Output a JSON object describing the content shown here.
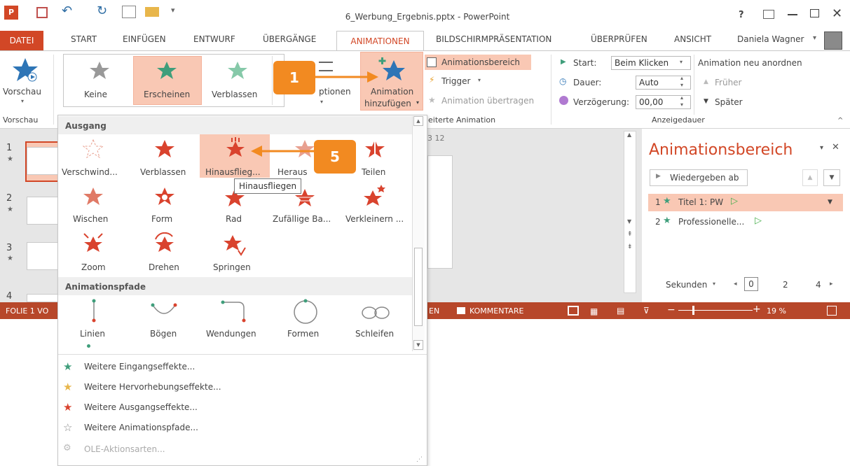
{
  "window": {
    "title": "6_Werbung_Ergebnis.pptx - PowerPoint",
    "help": "?",
    "user": "Daniela Wagner"
  },
  "tabs": [
    {
      "label": "DATEI"
    },
    {
      "label": "START"
    },
    {
      "label": "EINFÜGEN"
    },
    {
      "label": "ENTWURF"
    },
    {
      "label": "ÜBERGÄNGE"
    },
    {
      "label": "ANIMATIONEN"
    },
    {
      "label": "BILDSCHIRMPRÄSENTATION"
    },
    {
      "label": "ÜBERPRÜFEN"
    },
    {
      "label": "ANSICHT"
    }
  ],
  "ribbon": {
    "preview_button": "Vorschau",
    "preview_group": "Vorschau",
    "gallery": [
      "Keine",
      "Erscheinen",
      "Verblassen"
    ],
    "effect_options_partial": "ptionen",
    "add_animation_line1": "Animation",
    "add_animation_line2": "hinzufügen",
    "animation_pane_button": "Animationsbereich",
    "trigger_button": "Trigger",
    "copy_animation_button": "Animation übertragen",
    "advanced_group_partial": "eiterte Animation",
    "start_label": "Start:",
    "start_value": "Beim Klicken",
    "duration_label": "Dauer:",
    "duration_value": "Auto",
    "delay_label": "Verzögerung:",
    "delay_value": "00,00",
    "timing_group": "Anzeigedauer",
    "reorder_title": "Animation neu anordnen",
    "earlier": "Früher",
    "later": "Später"
  },
  "dropdown": {
    "exit_header": "Ausgang",
    "exit_effects": [
      "Verschwind...",
      "Verblassen",
      "Hinausflieg...",
      "Heraus",
      "Teilen",
      "Wischen",
      "Form",
      "Rad",
      "Zufällige Ba...",
      "Verkleinern ...",
      "Zoom",
      "Drehen",
      "Springen"
    ],
    "paths_header": "Animationspfade",
    "path_effects": [
      "Linien",
      "Bögen",
      "Wendungen",
      "Formen",
      "Schleifen"
    ],
    "tooltip": "Hinausfliegen",
    "menu_items": [
      {
        "label": "Weitere Eingangseffekte...",
        "color": "#3f9e7b"
      },
      {
        "label": "Weitere Hervorhebungseffekte...",
        "color": "#e8b64b"
      },
      {
        "label": "Weitere Ausgangseffekte...",
        "color": "#d9432e"
      },
      {
        "label": "Weitere Animationspfade...",
        "color": "#888888"
      },
      {
        "label": "OLE-Aktionsarten...",
        "color": "#bbbbbb"
      }
    ]
  },
  "slides": {
    "numbers": [
      "1",
      "2",
      "3",
      "4"
    ],
    "ruler_partial": "3 12"
  },
  "animation_pane": {
    "title": "Animationsbereich",
    "play_from": "Wiedergeben ab",
    "items": [
      {
        "num": "1",
        "label": "Titel 1: PW"
      },
      {
        "num": "2",
        "label": "Professionelle..."
      }
    ],
    "seconds_label": "Sekunden",
    "timeline": [
      "0",
      "2",
      "4"
    ]
  },
  "statusbar": {
    "slide_info": "FOLIE 1 VO",
    "notes_partial": "EN",
    "comments": "KOMMENTARE",
    "zoom": "19 %"
  },
  "callouts": [
    "1",
    "5"
  ],
  "colors": {
    "accent": "#d24726",
    "statusbar": "#b7472a",
    "callout": "#f28a21",
    "highlight": "#f9c8b4"
  }
}
